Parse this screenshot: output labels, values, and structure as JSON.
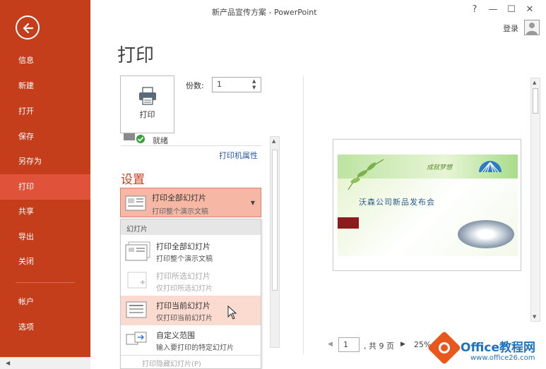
{
  "window": {
    "title": "新产品宣传方案 - PowerPoint",
    "help": "?",
    "minimize": "—",
    "maximize": "☐",
    "close": "✕"
  },
  "account": {
    "login": "登录"
  },
  "sidebar": {
    "items": [
      {
        "label": "信息"
      },
      {
        "label": "新建"
      },
      {
        "label": "打开"
      },
      {
        "label": "保存"
      },
      {
        "label": "另存为"
      },
      {
        "label": "打印"
      },
      {
        "label": "共享"
      },
      {
        "label": "导出"
      },
      {
        "label": "关闭"
      },
      {
        "label": "帐户"
      },
      {
        "label": "选项"
      }
    ]
  },
  "page_title": "打印",
  "print": {
    "button_label": "打印",
    "copies_label": "份数:",
    "copies_value": "1",
    "printer_status": "就绪",
    "printer_properties": "打印机属性"
  },
  "settings": {
    "title": "设置",
    "selected": {
      "title": "打印全部幻灯片",
      "desc": "打印整个演示文稿"
    },
    "list_header": "幻灯片",
    "options": [
      {
        "title": "打印全部幻灯片",
        "desc": "打印整个演示文稿"
      },
      {
        "title": "打印所选幻灯片",
        "desc": "仅打印所选幻灯片"
      },
      {
        "title": "打印当前幻灯片",
        "desc": "仅打印当前幻灯片"
      },
      {
        "title": "自定义范围",
        "desc": "输入要打印的特定幻灯片"
      }
    ],
    "footer": "打印隐藏幻灯片(P)"
  },
  "preview": {
    "slide_title": "沃森公司新品发布会",
    "slide_subtitle": "成就梦想",
    "page_value": "1",
    "page_total": ", 共 9 页",
    "zoom": "25%"
  },
  "watermark": {
    "brand": "Office教程网",
    "url": "www.office26.com"
  },
  "colors": {
    "sidebar": "#c43e1c",
    "active": "#e0523a",
    "accent_text": "#c43e1c",
    "highlight": "#fbdad0"
  }
}
